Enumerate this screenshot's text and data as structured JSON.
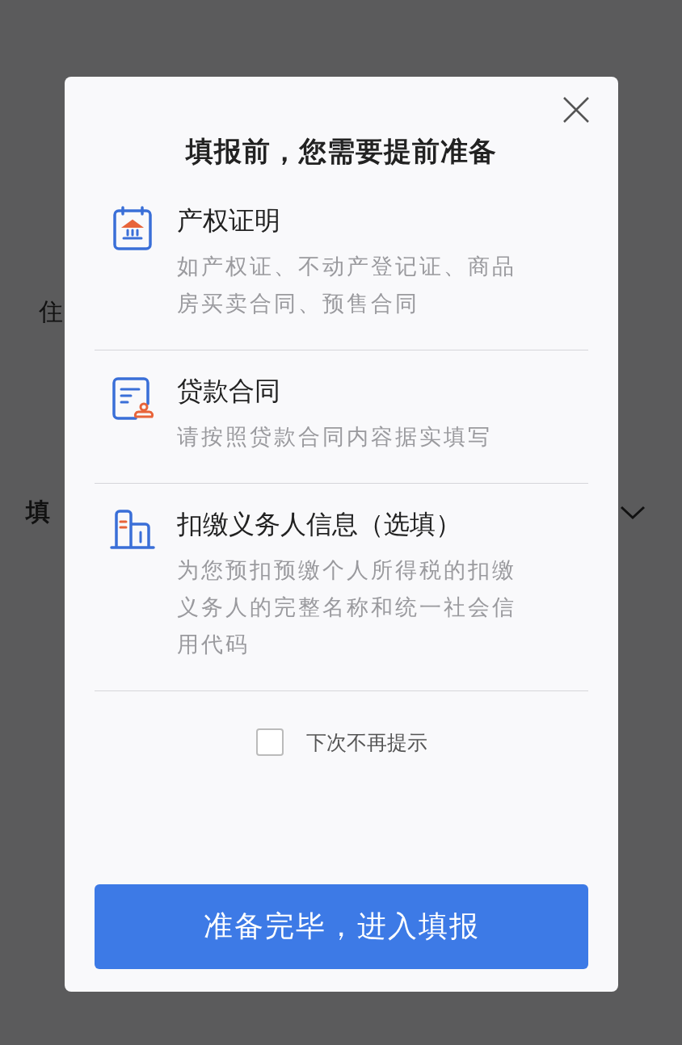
{
  "background": {
    "texts": [
      "住",
      "填"
    ]
  },
  "dialog": {
    "title": "填报前，您需要提前准备",
    "items": [
      {
        "kind": "property",
        "title": "产权证明",
        "description": "如产权证、不动产登记证、商品房买卖合同、预售合同"
      },
      {
        "kind": "contract",
        "title": "贷款合同",
        "description": "请按照贷款合同内容据实填写"
      },
      {
        "kind": "building",
        "title": "扣缴义务人信息（选填）",
        "description": "为您预扣预缴个人所得税的扣缴义务人的完整名称和统一社会信用代码"
      }
    ],
    "dont_show_again": {
      "label": "下次不再提示",
      "checked": false
    },
    "confirm_button": "准备完毕，进入填报"
  }
}
